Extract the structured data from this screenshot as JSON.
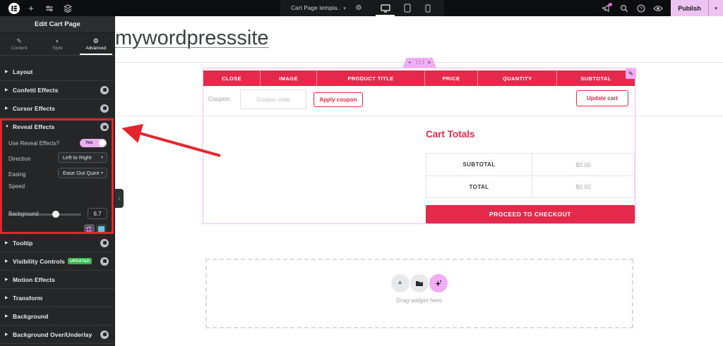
{
  "topbar": {
    "document_title": "Cart Page templa..",
    "publish_label": "Publish"
  },
  "sidebar": {
    "header": "Edit Cart Page",
    "tabs": [
      {
        "label": "Content"
      },
      {
        "label": "Style"
      },
      {
        "label": "Advanced"
      }
    ],
    "sections_top": [
      {
        "label": "Layout"
      },
      {
        "label": "Confetti Effects"
      },
      {
        "label": "Cursor Effects"
      }
    ],
    "reveal": {
      "label": "Reveal Effects",
      "toggle_label": "Use Reveal Effects?",
      "toggle_value": "Yes",
      "direction_label": "Direction",
      "direction_value": "Left to Right",
      "easing_label": "Easing",
      "easing_value": "Ease Out Quint",
      "speed_label": "Speed",
      "speed_value": "6.7",
      "background_label": "Background"
    },
    "sections_bottom": [
      {
        "label": "Tooltip"
      },
      {
        "label": "Visibility Controls",
        "tag": "UPDATED"
      },
      {
        "label": "Motion Effects"
      },
      {
        "label": "Transform"
      },
      {
        "label": "Background"
      },
      {
        "label": "Background Over/Underlay"
      }
    ]
  },
  "canvas": {
    "site_title": "mywordpresssite",
    "cart": {
      "columns": [
        "CLOSE",
        "IMAGE",
        "PRODUCT TITLE",
        "PRICE",
        "QUANTITY",
        "SUBTOTAL"
      ],
      "coupon_label": "Coupon:",
      "coupon_placeholder": "Coupon code",
      "apply_label": "Apply coupon",
      "update_label": "Update cart",
      "totals_title": "Cart Totals",
      "rows": [
        [
          "SUBTOTAL",
          "$0.00"
        ],
        [
          "TOTAL",
          "$0.00"
        ]
      ],
      "checkout_label": "PROCEED TO CHECKOUT"
    },
    "drag_hint": "Drag widget here"
  },
  "colors": {
    "accent_pink": "#f2abf5",
    "theme_red": "#e4294b",
    "badge_green": "#39b54a",
    "annotation_red": "#e3262b",
    "topbar_bg": "#0c0d0e",
    "sidebar_bg": "#242628"
  }
}
